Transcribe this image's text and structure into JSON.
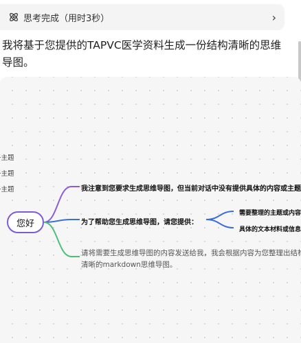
{
  "thinking": {
    "label": "思考完成（用时3秒）",
    "icon": "atom-icon",
    "expand_icon": "chevron-right-icon"
  },
  "message": {
    "intro": "我将基于您提供的TAPVC医学资料生成一份结构清晰的思维导图。"
  },
  "mindmap": {
    "side_labels": [
      "子主题",
      "子主题",
      "子主题"
    ],
    "root": "您好",
    "branches": [
      {
        "text": "我注意到您要求生成思维导图，但当前对话中没有提供具体的内容或主题",
        "color": "#8a5cd6"
      },
      {
        "text": "为了帮助您生成思维导图，请您提供：",
        "color": "#3b6fd6",
        "children": [
          "需要整理的主题或内容",
          "具体的文本材料或信息"
        ]
      },
      {
        "text": "请将需要生成思维导图的内容发送给我，我会根据内容为您整理出结构清晰的markdown思维导图。",
        "color": "#4bbf7a"
      }
    ]
  }
}
